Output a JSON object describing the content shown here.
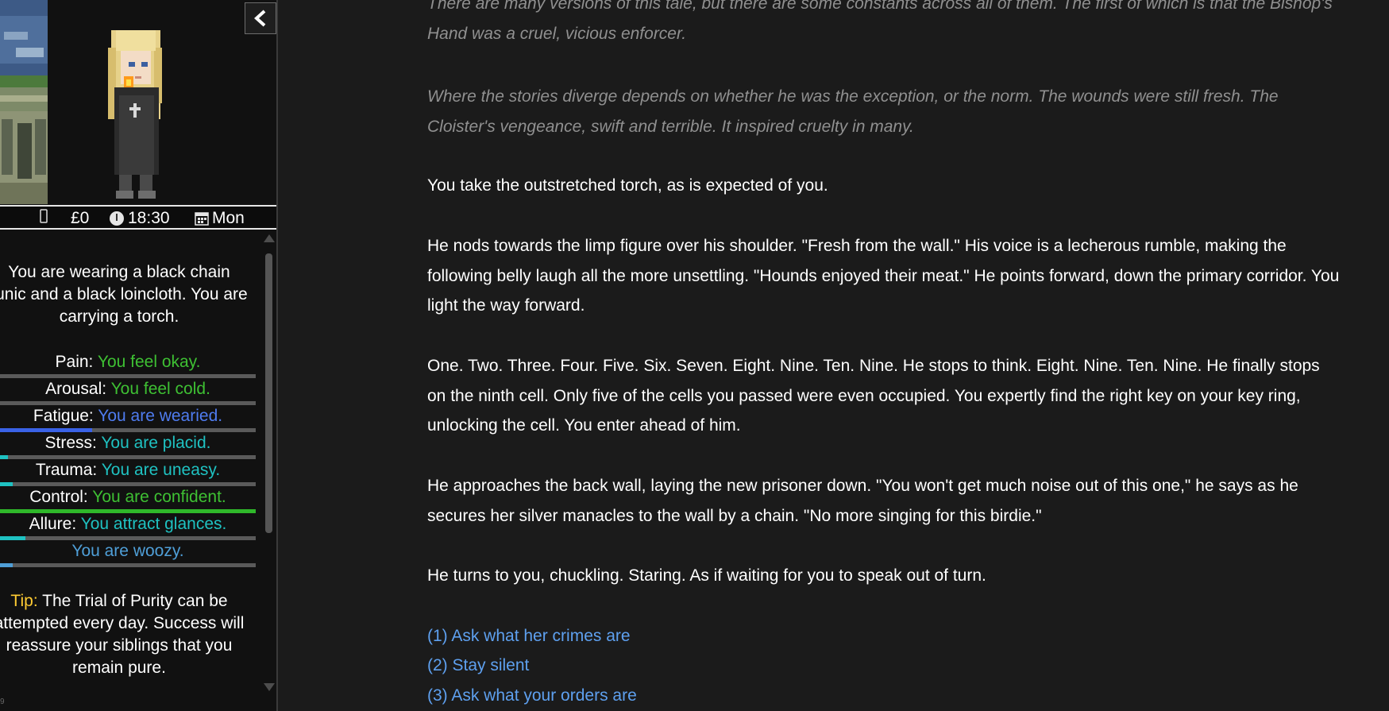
{
  "sidebar": {
    "status": {
      "money": "£0",
      "time": "18:30",
      "day": "Mon"
    },
    "clothing_text": "You are wearing a black chain tunic and a black loincloth. You are carrying a torch.",
    "stats": [
      {
        "label": "Pain:",
        "value": "You feel okay.",
        "color": "#3ec033",
        "fill_fraction": 0.0,
        "fill_color": "#3ec033"
      },
      {
        "label": "Arousal:",
        "value": "You feel cold.",
        "color": "#3ec033",
        "fill_fraction": 0.0,
        "fill_color": "#3ec033"
      },
      {
        "label": "Fatigue:",
        "value": "You are wearied.",
        "color": "#4f7cf0",
        "fill_fraction": 0.36,
        "fill_color": "#3a62e6"
      },
      {
        "label": "Stress:",
        "value": "You are placid.",
        "color": "#1fc2c2",
        "fill_fraction": 0.03,
        "fill_color": "#1fc2c2"
      },
      {
        "label": "Trauma:",
        "value": "You are uneasy.",
        "color": "#1fc2c2",
        "fill_fraction": 0.05,
        "fill_color": "#1fc2c2"
      },
      {
        "label": "Control:",
        "value": "You are confident.",
        "color": "#3ec033",
        "fill_fraction": 1.0,
        "fill_color": "#2fb82a"
      },
      {
        "label": "Allure:",
        "value": "You attract glances.",
        "color": "#1fc2c2",
        "fill_fraction": 0.1,
        "fill_color": "#1fc2c2"
      },
      {
        "label": "",
        "value": "You are woozy.",
        "color": "#4f9fd8",
        "fill_fraction": 0.05,
        "fill_color": "#4f9fd8"
      }
    ],
    "tip_label": "Tip:",
    "tip_text": "The Trial of Purity can be attempted every day. Success will reassure your siblings that you remain pure.",
    "version": "9"
  },
  "passage": {
    "paragraphs": [
      {
        "style": "italic",
        "text": "There are many versions of this tale, but there are some constants across all of them. The first of which is that the Bishop's Hand was a cruel, vicious enforcer."
      },
      {
        "style": "italic",
        "text": "Where the stories diverge depends on whether he was the exception, or the norm. The wounds were still fresh. The Cloister's vengeance, swift and terrible. It inspired cruelty in many."
      },
      {
        "style": "plain",
        "text": "You take the outstretched torch, as is expected of you."
      },
      {
        "style": "plain",
        "text": "He nods towards the limp figure over his shoulder. \"Fresh from the wall.\" His voice is a lecherous rumble, making the following belly laugh all the more unsettling. \"Hounds enjoyed their meat.\" He points forward, down the primary corridor. You light the way forward."
      },
      {
        "style": "plain",
        "text": "One. Two. Three. Four. Five. Six. Seven. Eight. Nine. Ten. Nine. He stops to think. Eight. Nine. Ten. Nine. He finally stops on the ninth cell. Only five of the cells you passed were even occupied. You expertly find the right key on your key ring, unlocking the cell. You enter ahead of him."
      },
      {
        "style": "plain",
        "text": "He approaches the back wall, laying the new prisoner down. \"You won't get much noise out of this one,\" he says as he secures her silver manacles to the wall by a chain. \"No more singing for this birdie.\""
      },
      {
        "style": "plain",
        "text": "He turns to you, chuckling. Staring. As if waiting for you to speak out of turn."
      }
    ],
    "choices": [
      "(1) Ask what her crimes are",
      "(2) Stay silent",
      "(3) Ask what your orders are"
    ]
  }
}
